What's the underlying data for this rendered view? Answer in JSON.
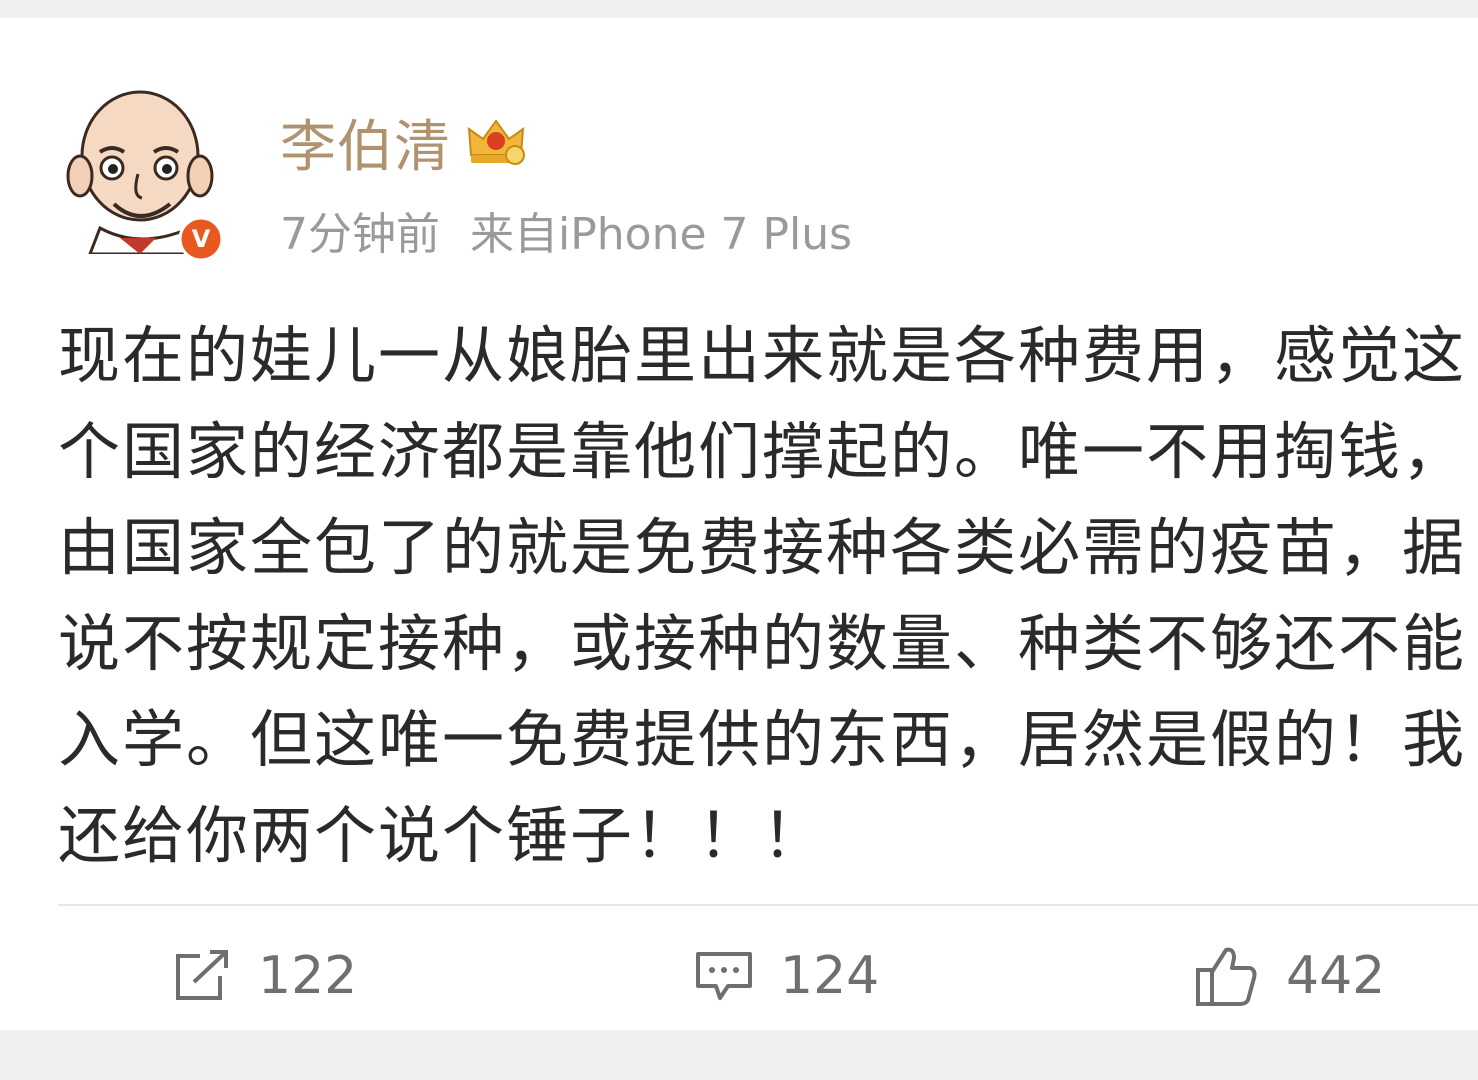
{
  "post": {
    "user_name": "李伯清",
    "time": "7分钟前",
    "source": "来自iPhone 7 Plus",
    "text": "现在的娃儿一从娘胎里出来就是各种费用，感觉这个国家的经济都是靠他们撑起的。唯一不用掏钱，由国家全包了的就是免费接种各类必需的疫苗，据说不按规定接种，或接种的数量、种类不够还不能入学。但这唯一免费提供的东西，居然是假的！我还给你两个说个锤子！！！",
    "verified_badge": "V"
  },
  "actions": {
    "repost_count": "122",
    "comment_count": "124",
    "like_count": "442"
  },
  "icons": {
    "repost": "repost-icon",
    "comment": "comment-icon",
    "like": "thumbs-up-icon",
    "crown": "crown-icon",
    "verified": "verified-badge-icon"
  },
  "colors": {
    "user_name": "#b0926e",
    "meta": "#9a9a9a",
    "body_text": "#2a2a2a",
    "action": "#6f6f6f",
    "verified_badge": "#e8581f",
    "crown": "#f2b63a"
  }
}
